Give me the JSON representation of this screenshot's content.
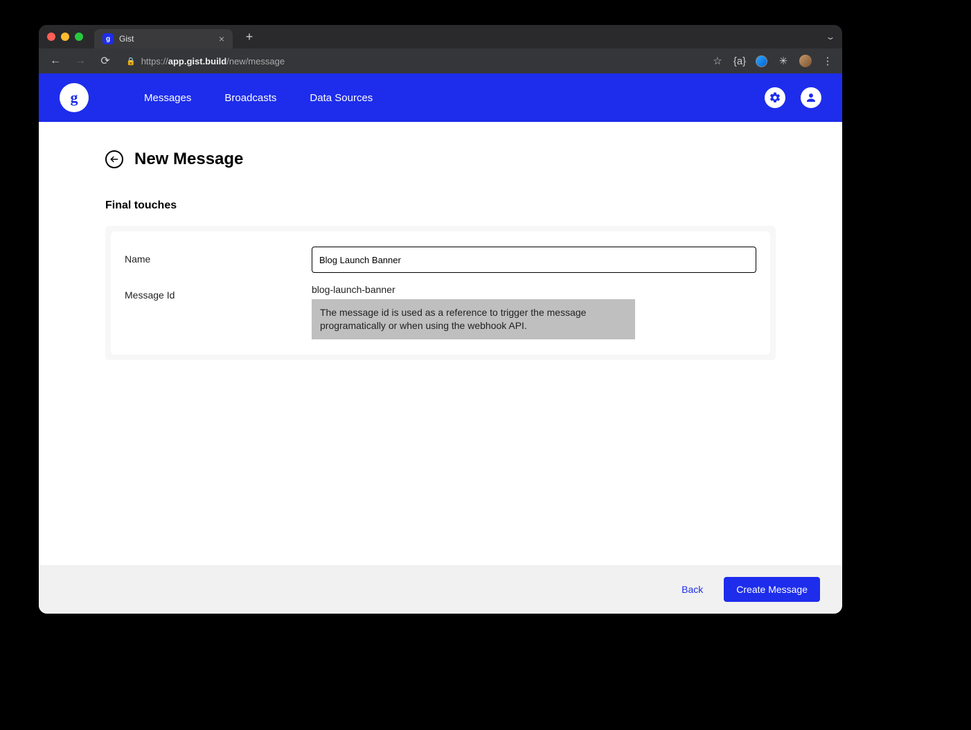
{
  "browser": {
    "tab": {
      "title": "Gist",
      "icon_letter": "g"
    },
    "url_proto": "https://",
    "url_host": "app.gist.build",
    "url_path": "/new/message"
  },
  "header": {
    "logo_letter": "g",
    "nav": {
      "messages": "Messages",
      "broadcasts": "Broadcasts",
      "data_sources": "Data Sources"
    }
  },
  "page": {
    "title": "New Message",
    "section": "Final touches",
    "fields": {
      "name_label": "Name",
      "name_value": "Blog Launch Banner",
      "msgid_label": "Message Id",
      "msgid_slug": "blog-launch-banner",
      "msgid_help": "The message id is used as a reference to trigger the message programatically or when using the webhook API."
    }
  },
  "footer": {
    "back": "Back",
    "submit": "Create Message"
  }
}
